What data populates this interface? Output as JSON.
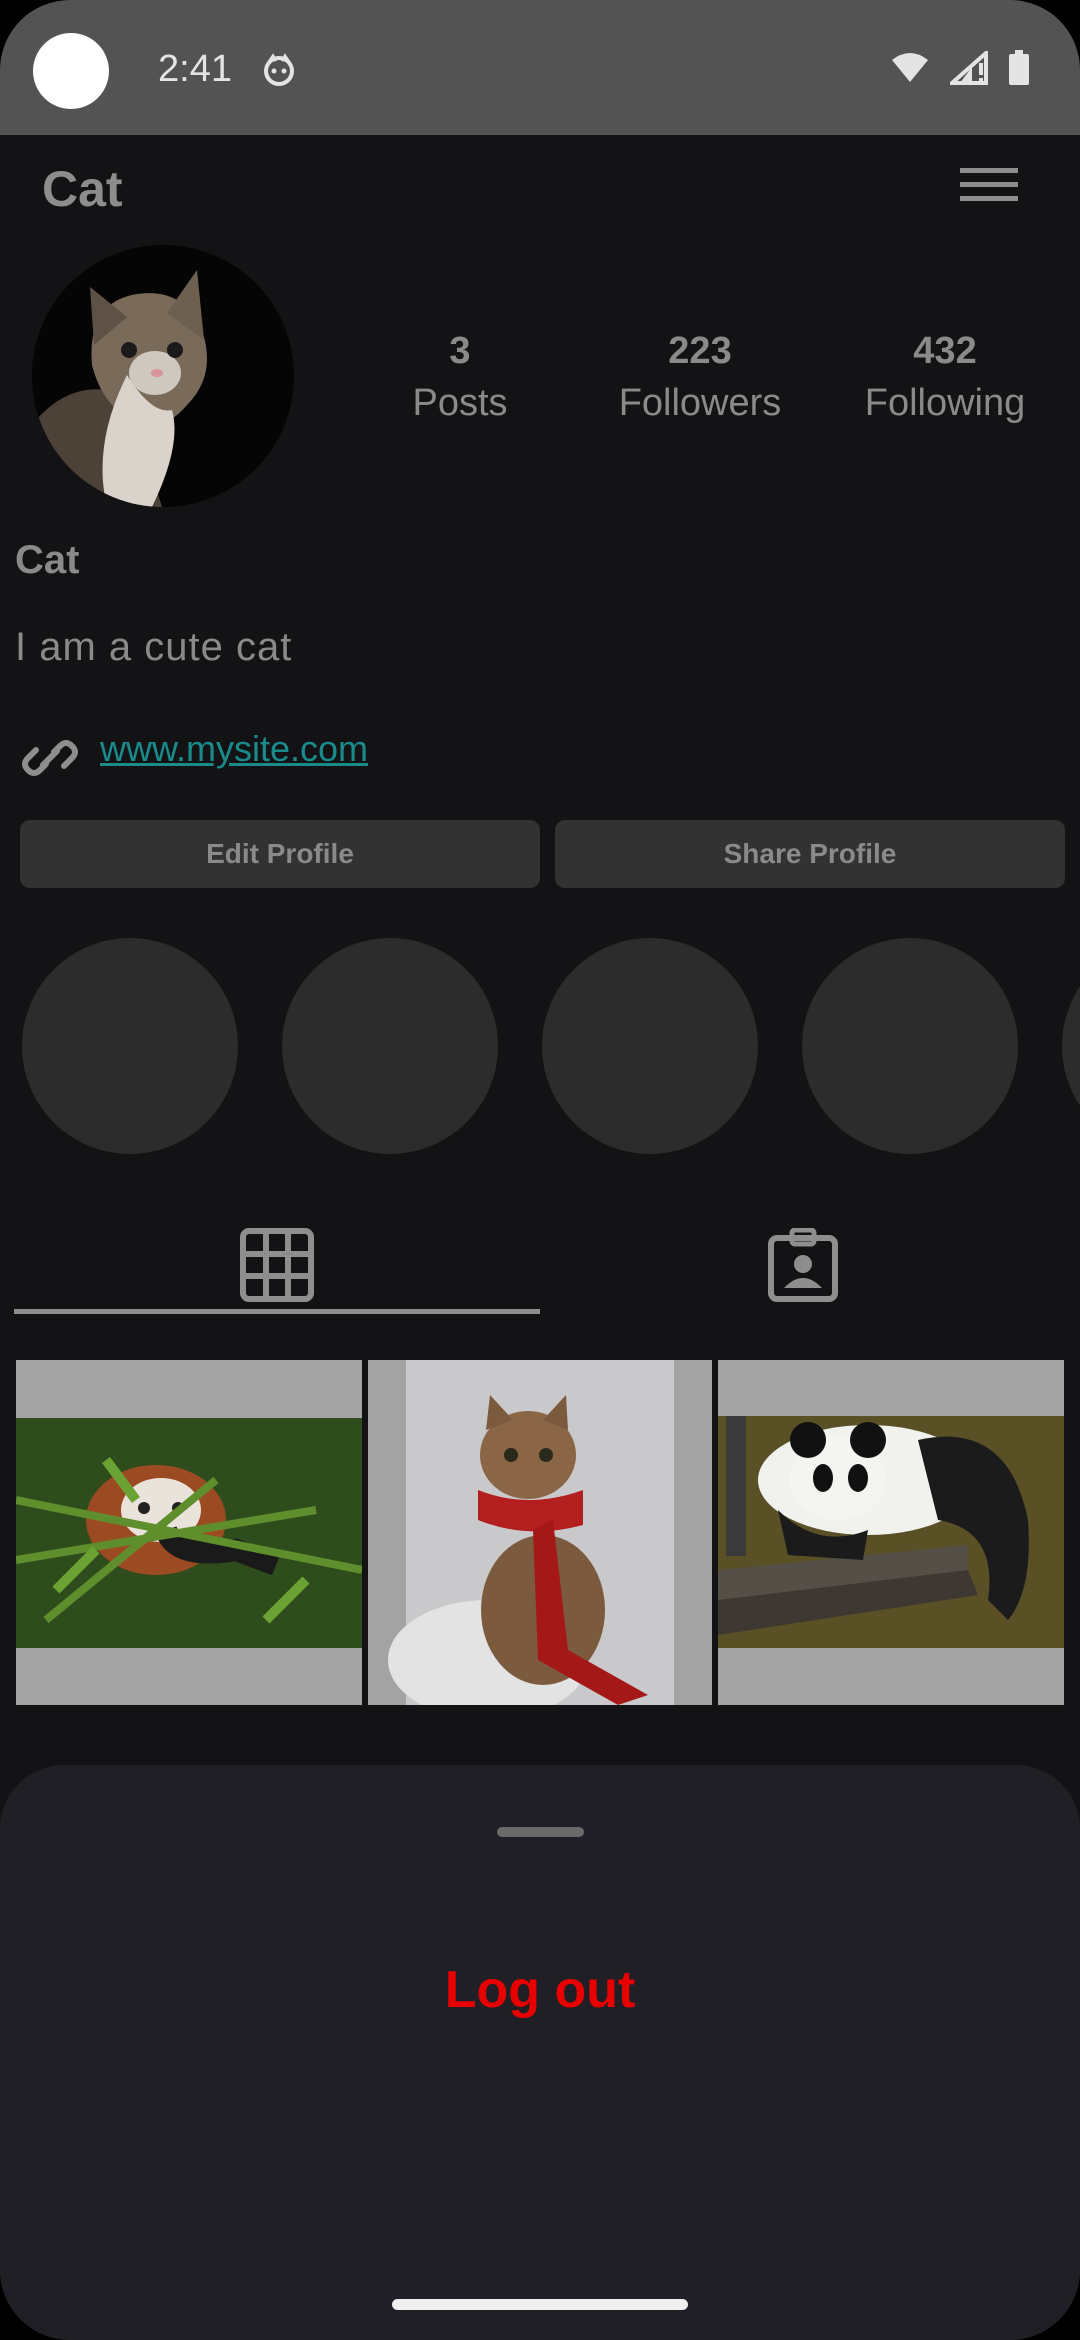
{
  "status_bar": {
    "time": "2:41"
  },
  "app": {
    "title": "Cat"
  },
  "profile": {
    "name": "Cat",
    "bio": "I am a cute cat",
    "link": "www.mysite.com",
    "stats": [
      {
        "value": "3",
        "label": "Posts"
      },
      {
        "value": "223",
        "label": "Followers"
      },
      {
        "value": "432",
        "label": "Following"
      }
    ]
  },
  "buttons": {
    "edit": "Edit Profile",
    "share": "Share Profile"
  },
  "tabs": {
    "selected": "grid"
  },
  "posts": [
    "red panda in bamboo",
    "cat wearing red scarf",
    "panda lying on wooden plank"
  ],
  "bottom_sheet": {
    "logout_label": "Log out"
  },
  "colors": {
    "logout": "#e80000",
    "link": "#1a8b8b"
  }
}
